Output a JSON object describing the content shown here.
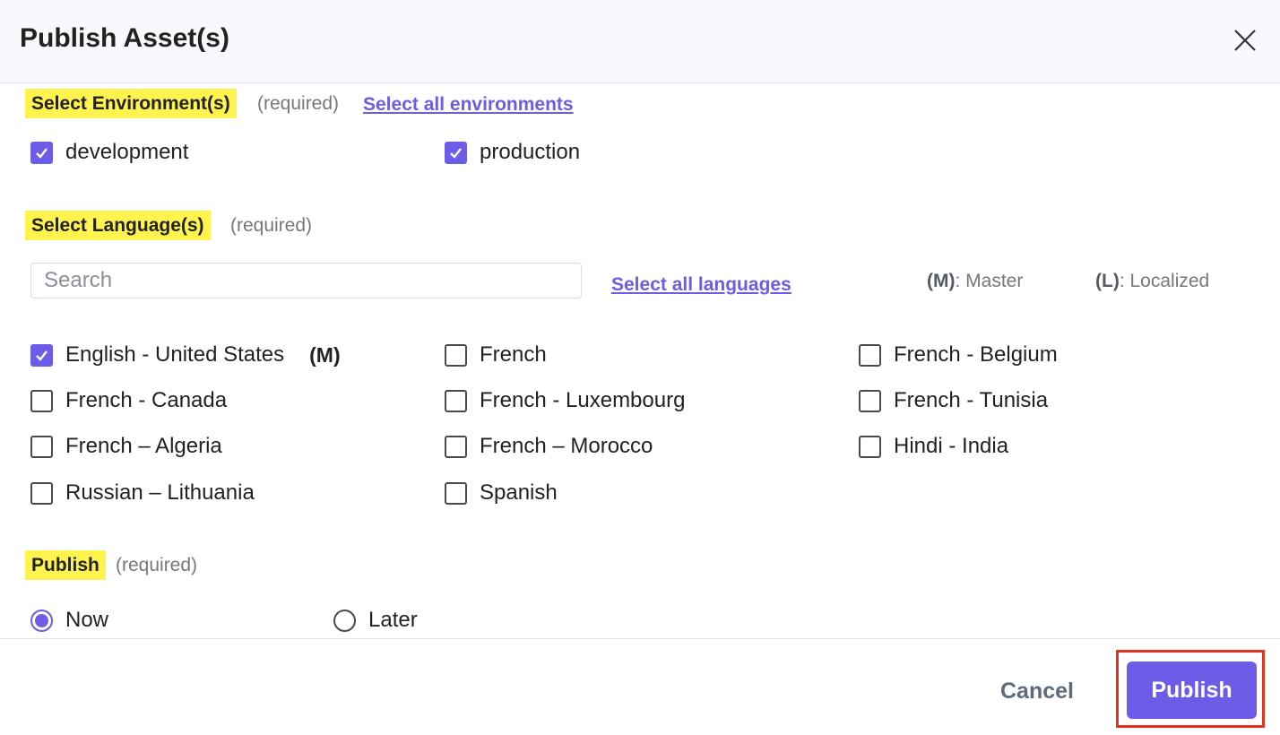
{
  "dialog": {
    "title": "Publish Asset(s)"
  },
  "environments": {
    "label": "Select Environment(s)",
    "required": "(required)",
    "select_all": "Select all environments",
    "items": [
      {
        "label": "development",
        "checked": true
      },
      {
        "label": "production",
        "checked": true
      }
    ]
  },
  "languages": {
    "label": "Select Language(s)",
    "required": "(required)",
    "search_placeholder": "Search",
    "search_value": "",
    "select_all": "Select all languages",
    "legend_master_key": "(M)",
    "legend_master_text": ": Master",
    "legend_localized_key": "(L)",
    "legend_localized_text": ": Localized",
    "items": [
      {
        "label": "English - United States",
        "checked": true,
        "tag": "(M)"
      },
      {
        "label": "French",
        "checked": false
      },
      {
        "label": "French - Belgium",
        "checked": false
      },
      {
        "label": "French - Canada",
        "checked": false
      },
      {
        "label": "French - Luxembourg",
        "checked": false
      },
      {
        "label": "French - Tunisia",
        "checked": false
      },
      {
        "label": "French – Algeria",
        "checked": false
      },
      {
        "label": "French – Morocco",
        "checked": false
      },
      {
        "label": "Hindi - India",
        "checked": false
      },
      {
        "label": "Russian – Lithuania",
        "checked": false
      },
      {
        "label": "Spanish",
        "checked": false
      }
    ]
  },
  "publish": {
    "label": "Publish",
    "required": "(required)",
    "options": [
      {
        "label": "Now",
        "selected": true
      },
      {
        "label": "Later",
        "selected": false
      }
    ]
  },
  "footer": {
    "cancel_label": "Cancel",
    "publish_label": "Publish"
  },
  "colors": {
    "accent": "#6c5ce7",
    "highlight": "#fff44f",
    "annotation_frame": "#e0341f"
  }
}
